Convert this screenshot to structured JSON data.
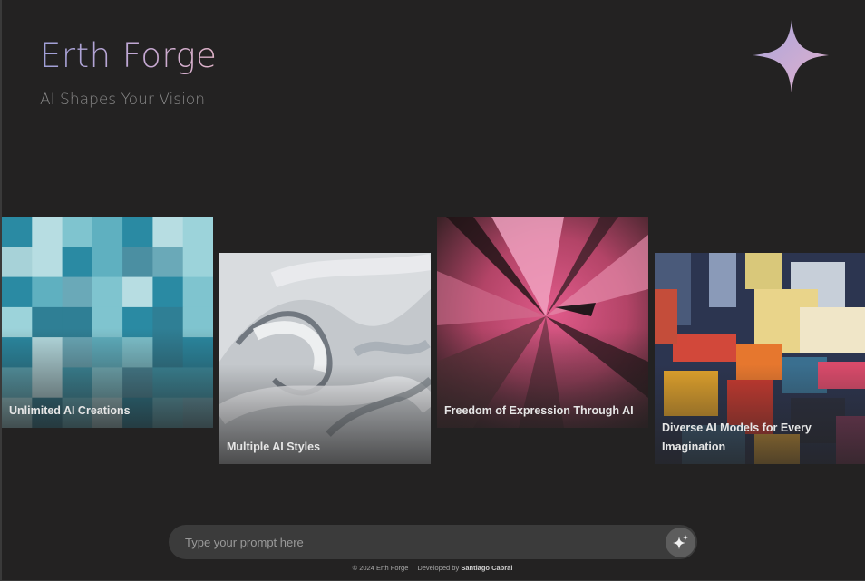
{
  "header": {
    "title": "Erth Forge",
    "subtitle": "AI Shapes Your Vision",
    "logo_icon": "four-point-sparkle-icon"
  },
  "cards": [
    {
      "caption": "Unlimited AI Creations",
      "art": "teal-mosaic"
    },
    {
      "caption": "Multiple AI Styles",
      "art": "grey-waves"
    },
    {
      "caption": "Freedom of Expression Through AI",
      "art": "pink-burst"
    },
    {
      "caption": "Diverse AI Models for Every Imagination",
      "art": "colorful-abstract"
    }
  ],
  "prompt": {
    "placeholder": "Type your prompt here",
    "value": "",
    "send_icon": "sparkles-icon"
  },
  "footer": {
    "copyright": "© 2024 Erth Forge",
    "separator": "|",
    "developed_by": "Developed by",
    "developer": "Santiago Cabral"
  },
  "colors": {
    "background": "#232222",
    "title_gradient_start": "#9fa0d8",
    "title_gradient_end": "#e0b3c8",
    "input_bg": "#3b3b3b"
  }
}
